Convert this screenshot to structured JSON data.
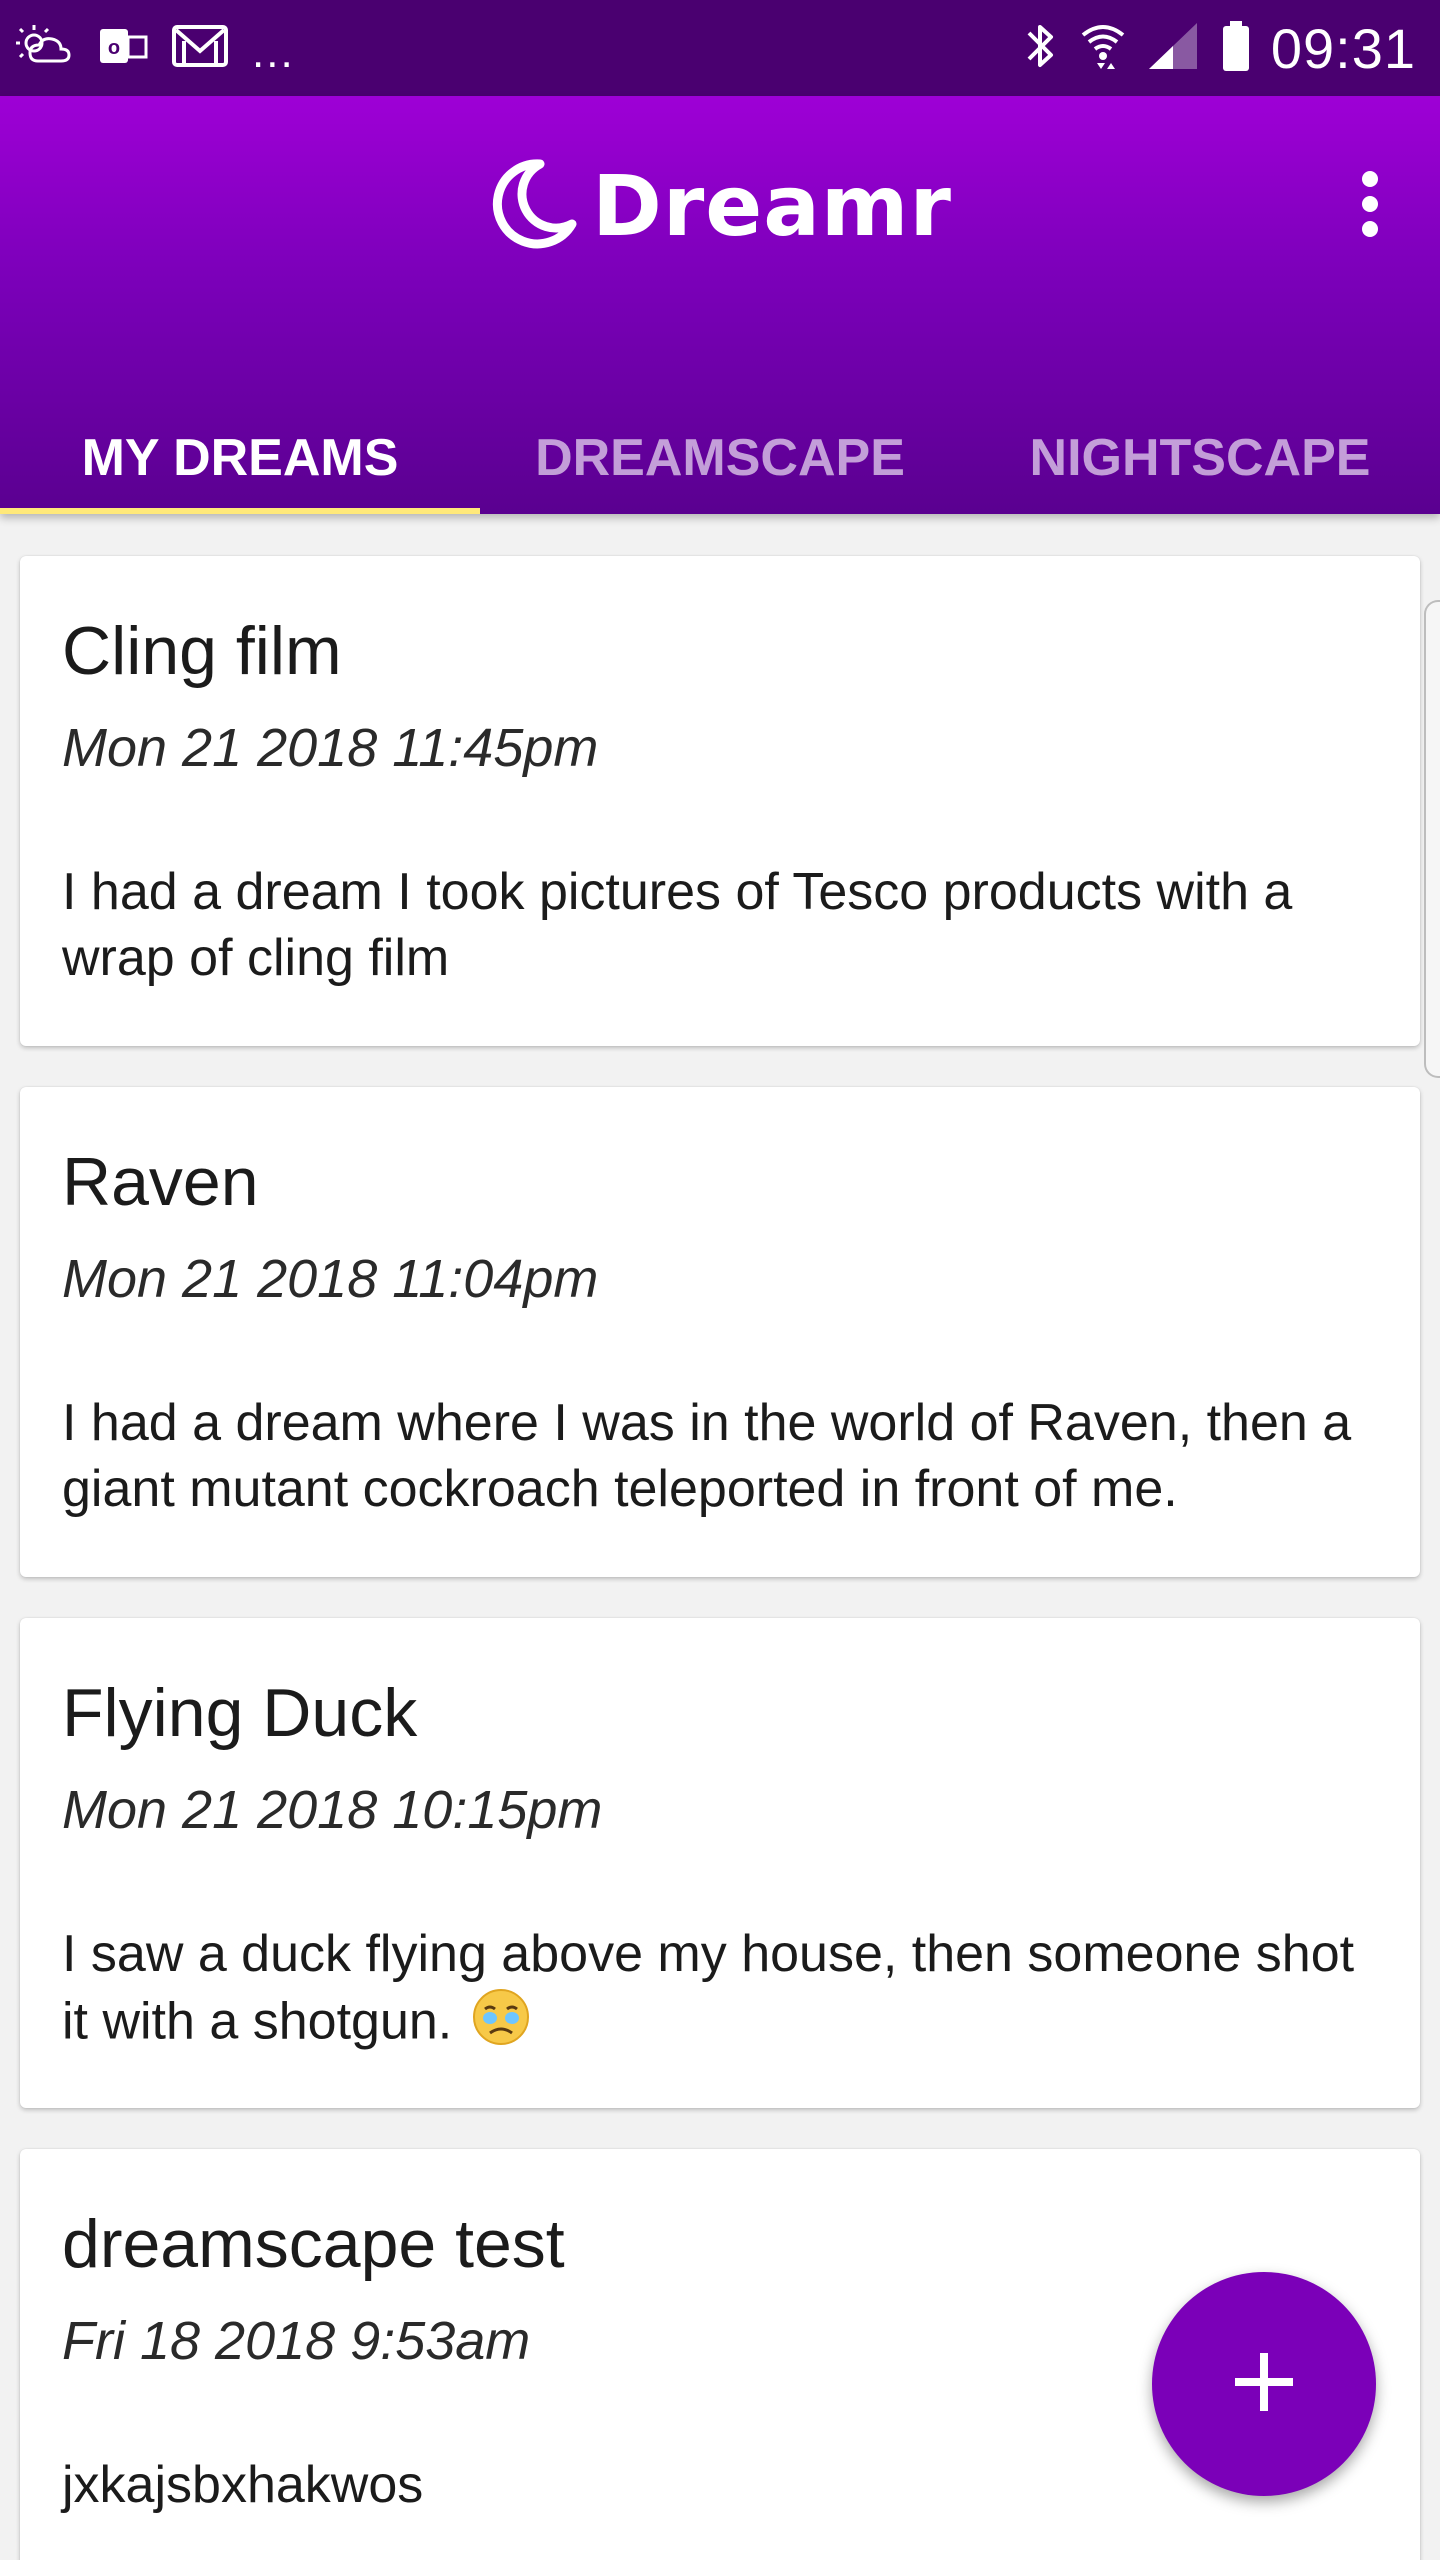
{
  "status_bar": {
    "overflow_indicator": "...",
    "time": "09:31",
    "icons": [
      "weather-icon",
      "outlook-icon",
      "email-icon",
      "bluetooth-icon",
      "wifi-icon",
      "signal-icon",
      "battery-icon"
    ]
  },
  "app_bar": {
    "title": "Dreamr",
    "logo_icon": "moon-icon",
    "menu_icon": "more-vert-icon"
  },
  "tabs": [
    {
      "label": "MY DREAMS",
      "active": true
    },
    {
      "label": "DREAMSCAPE",
      "active": false
    },
    {
      "label": "NIGHTSCAPE",
      "active": false
    }
  ],
  "dreams": [
    {
      "title": "Cling film",
      "date": "Mon 21 2018 11:45pm",
      "body": "I had a dream I took pictures of Tesco products with a wrap of cling film"
    },
    {
      "title": "Raven",
      "date": "Mon 21 2018 11:04pm",
      "body": "I had a dream where I was in the world of Raven, then a giant mutant cockroach teleported in front of me."
    },
    {
      "title": "Flying Duck",
      "date": "Mon 21 2018 10:15pm",
      "body": "I saw a duck flying above my house, then someone shot it with a shotgun.",
      "emoji": "crying-face-icon"
    },
    {
      "title": "dreamscape test",
      "date": "Fri 18 2018 9:53am",
      "body": "jxkajsbxhakwos"
    }
  ],
  "fab": {
    "icon": "add-icon"
  },
  "colors": {
    "status_bar": "#4a0070",
    "app_bar_top": "#9e00d6",
    "app_bar_bottom": "#5a0090",
    "tab_indicator": "#ffe97a",
    "fab": "#7b00b8"
  }
}
